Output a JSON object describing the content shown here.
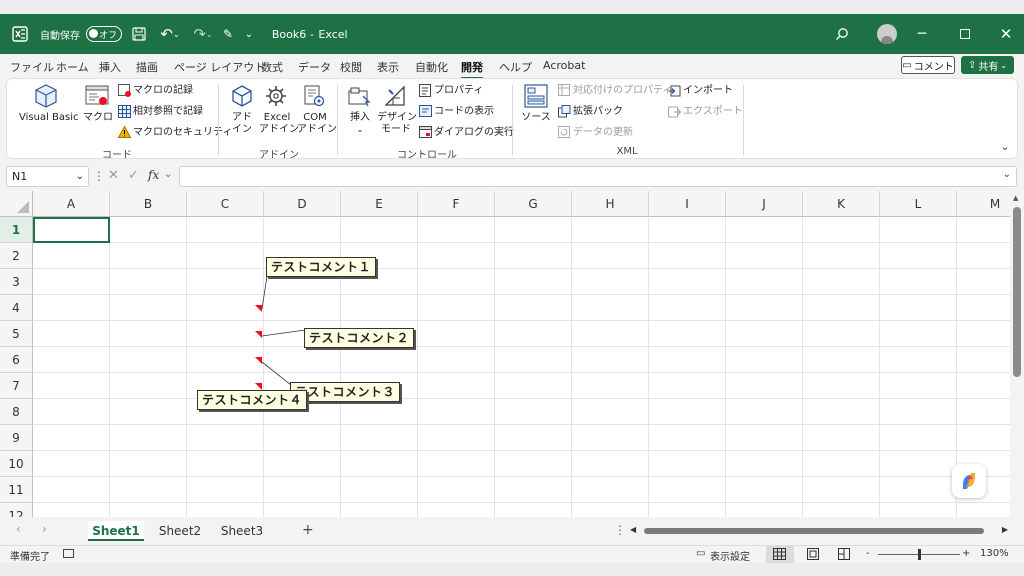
{
  "titlebar": {
    "autosave_label": "自動保存",
    "autosave_state": "オフ",
    "filename": "Book6",
    "separator": "-",
    "app": "Excel",
    "bg_color": "#1e7145"
  },
  "menu": {
    "items": [
      "ファイル",
      "ホーム",
      "挿入",
      "描画",
      "ページ レイアウト",
      "数式",
      "データ",
      "校閲",
      "表示",
      "自動化",
      "開発",
      "ヘルプ",
      "Acrobat"
    ],
    "active": "開発",
    "comment_button": "コメント",
    "share_button": "共有"
  },
  "ribbon": {
    "groups": {
      "code": "コード",
      "addin": "アドイン",
      "control": "コントロール",
      "xml": "XML"
    },
    "visual_basic": "Visual Basic",
    "macro": "マクロ",
    "record_macro": "マクロの記録",
    "relative_ref": "相対参照で記録",
    "macro_security": "マクロのセキュリティ",
    "addin_1": "アド",
    "addin_2": "イン",
    "excel_addin_1": "Excel",
    "excel_addin_2": "アドイン",
    "com_addin_1": "COM",
    "com_addin_2": "アドイン",
    "insert": "挿入",
    "design_mode_1": "デザイン",
    "design_mode_2": "モード",
    "properties": "プロパティ",
    "view_code": "コードの表示",
    "run_dialog": "ダイアログの実行",
    "source": "ソース",
    "map_properties": "対応付けのプロパティ",
    "expansion_packs": "拡張パック",
    "refresh_data": "データの更新",
    "import": "インポート",
    "export": "エクスポート"
  },
  "formula_bar": {
    "name_box": "N1",
    "fx": "fx",
    "value": ""
  },
  "grid": {
    "columns": [
      "A",
      "B",
      "C",
      "D",
      "E",
      "F",
      "G",
      "H",
      "I",
      "J",
      "K",
      "L",
      "M"
    ],
    "rows": [
      "1",
      "2",
      "3",
      "4",
      "5",
      "6",
      "7",
      "8",
      "9",
      "10",
      "11",
      "12"
    ],
    "selected_row": "1",
    "comments": [
      {
        "text": "テストコメント１",
        "cell": "C4"
      },
      {
        "text": "テストコメント２",
        "cell": "C5"
      },
      {
        "text": "テストコメント３",
        "cell": "C6"
      },
      {
        "text": "テストコメント４",
        "cell": "C7"
      }
    ]
  },
  "sheets": {
    "tabs": [
      "Sheet1",
      "Sheet2",
      "Sheet3"
    ],
    "active": "Sheet1",
    "add": "+"
  },
  "status": {
    "ready": "準備完了",
    "display_settings": "表示設定",
    "zoom": "130%",
    "zoom_minus": "-",
    "zoom_plus": "+"
  }
}
